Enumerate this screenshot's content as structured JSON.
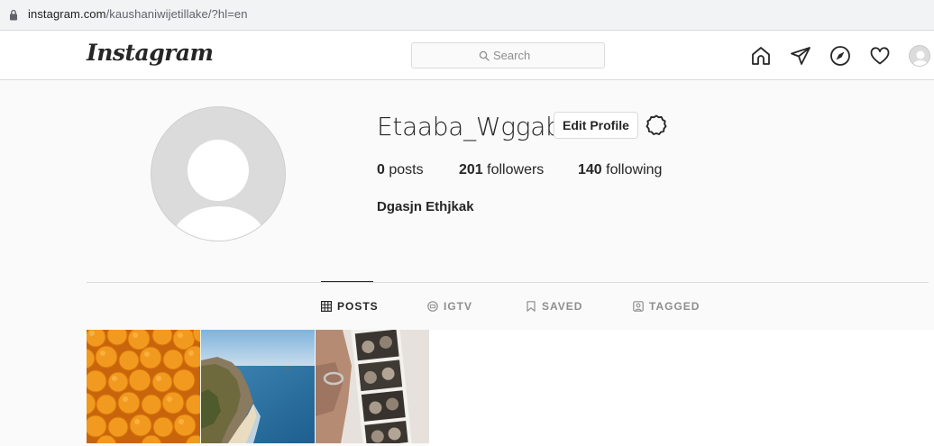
{
  "browser": {
    "url_host": "instagram.com",
    "url_path": "/kaushaniwijetillake/?hl=en"
  },
  "header": {
    "logo_text": "Instagram",
    "search_placeholder": "Search",
    "icons": [
      "home-icon",
      "direct-message-icon",
      "explore-icon",
      "activity-heart-icon",
      "profile-avatar"
    ]
  },
  "profile": {
    "username": "Etaaba_Wggab",
    "edit_button_label": "Edit Profile",
    "stats": [
      {
        "count": "0",
        "label": "posts"
      },
      {
        "count": "201",
        "label": "followers"
      },
      {
        "count": "140",
        "label": "following"
      }
    ],
    "full_name": "Dgasjn Ethjkak"
  },
  "tabs": [
    {
      "label": "POSTS",
      "active": true,
      "icon": "grid-icon"
    },
    {
      "label": "IGTV",
      "active": false,
      "icon": "igtv-icon"
    },
    {
      "label": "SAVED",
      "active": false,
      "icon": "bookmark-icon"
    },
    {
      "label": "TAGGED",
      "active": false,
      "icon": "tagged-icon"
    }
  ],
  "posts": [
    {
      "subject": "oranges"
    },
    {
      "subject": "coastline"
    },
    {
      "subject": "photo-booth-strip"
    }
  ],
  "colors": {
    "text_primary": "#262626",
    "text_secondary": "#8e8e8e",
    "border": "#dbdbdb",
    "background": "#fafafa"
  }
}
